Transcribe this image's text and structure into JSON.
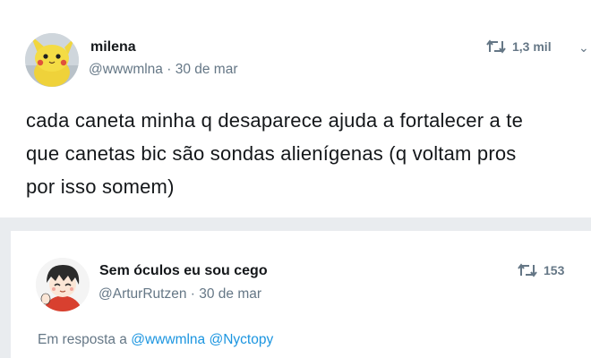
{
  "tweet": {
    "name": "milena",
    "handle": "@wwwmlna",
    "date": "30 de mar",
    "retweet_count": "1,3 mil",
    "lines": [
      "cada caneta minha q desaparece ajuda a fortalecer a te",
      "que canetas bic são sondas alienígenas (q voltam pros",
      "por isso somem)"
    ],
    "avatar_icon": "pikachu-plush-avatar",
    "chevron_icon": "chevron-down-icon"
  },
  "reply": {
    "name": "Sem óculos eu sou cego",
    "handle": "@ArturRutzen",
    "date": "30 de mar",
    "retweet_count": "153",
    "reply_prefix": "Em resposta a",
    "mentions": [
      "@wwwmlna",
      "@Nyctopy"
    ],
    "avatar_icon": "anime-boy-avatar"
  },
  "colors": {
    "text": "#14171a",
    "muted": "#657786",
    "link": "#1b95e0",
    "background": "#e9ecef"
  }
}
